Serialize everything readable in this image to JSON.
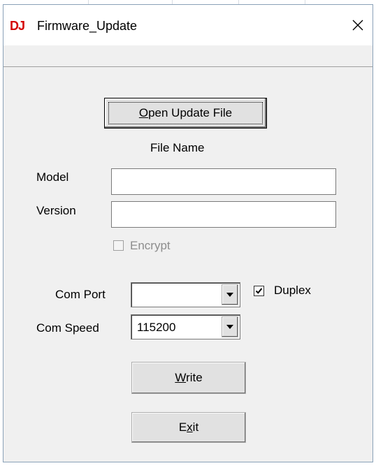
{
  "window": {
    "logo": "DJ",
    "title": "Firmware_Update",
    "close_glyph": "✕"
  },
  "form": {
    "open_button": {
      "label": "Open Update File",
      "mnemonic": "O",
      "rest": "pen Update File"
    },
    "file_name_label": "File Name",
    "model_label": "Model",
    "model_value": "",
    "version_label": "Version",
    "version_value": "",
    "encrypt_label": "Encrypt",
    "encrypt_checked": false,
    "encrypt_enabled": false,
    "com_port_label": "Com Port",
    "com_port_value": "",
    "duplex_label": "Duplex",
    "duplex_checked": true,
    "com_speed_label": "Com Speed",
    "com_speed_value": "115200",
    "write_button": {
      "label": "Write",
      "mnemonic": "W",
      "rest": "rite"
    },
    "exit_button": {
      "label": "Exit",
      "pre": "E",
      "mnemonic": "x",
      "rest": "it"
    }
  },
  "icons": {
    "dropdown": "chevron-down-icon",
    "check": "check-icon",
    "close": "close-icon"
  }
}
